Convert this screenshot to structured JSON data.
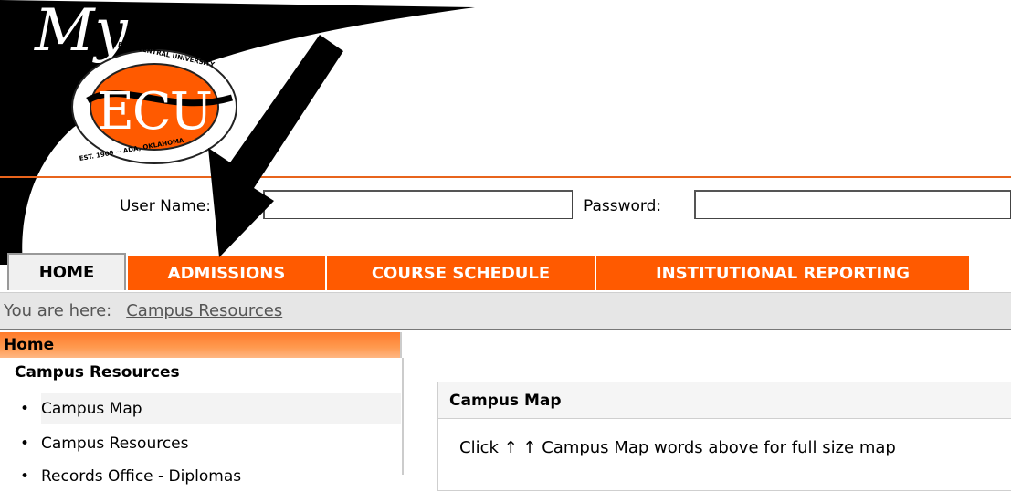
{
  "header": {
    "script_title": "My",
    "logo": {
      "initials": "ECU",
      "ring_top": "EAST CENTRAL UNIVERSITY",
      "ring_bottom": "EST. 1909 ~ ADA, OKLAHOMA"
    }
  },
  "login": {
    "username_label": "User Name:",
    "username_value": "",
    "password_label": "Password:",
    "password_value": ""
  },
  "tabs": [
    {
      "label": "HOME",
      "active": true
    },
    {
      "label": "ADMISSIONS",
      "active": false
    },
    {
      "label": "COURSE SCHEDULE",
      "active": false
    },
    {
      "label": "INSTITUTIONAL REPORTING",
      "active": false
    }
  ],
  "breadcrumb": {
    "prefix": "You are here:",
    "current": "Campus Resources"
  },
  "sidebar": {
    "home": "Home",
    "section": "Campus Resources",
    "items": [
      {
        "label": "Campus Map"
      },
      {
        "label": "Campus Resources"
      },
      {
        "label": "Records Office - Diplomas"
      }
    ]
  },
  "content": {
    "title": "Campus Map",
    "text": "Click ↑ ↑ Campus Map words above for full size map"
  },
  "colors": {
    "accent": "#ff5a00",
    "header_rule": "#e8641c",
    "breadcrumb_bg": "#e6e6e6"
  }
}
